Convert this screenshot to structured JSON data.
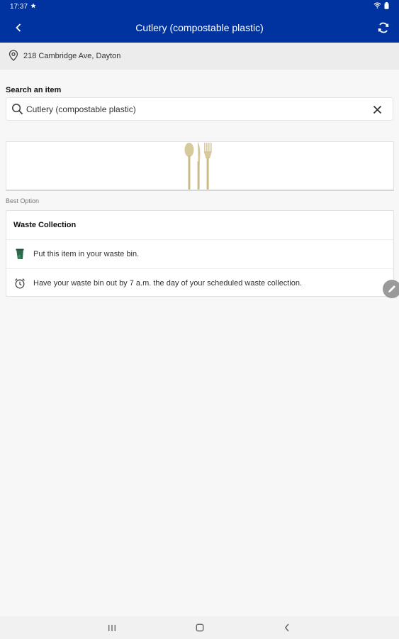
{
  "status_bar": {
    "time": "17:37"
  },
  "app_bar": {
    "title": "Cutlery (compostable plastic)"
  },
  "location": {
    "address": "218 Cambridge Ave, Dayton"
  },
  "search": {
    "label": "Search an item",
    "value": "Cutlery (compostable plastic)"
  },
  "best_option": {
    "label": "Best Option"
  },
  "result_card": {
    "title": "Waste Collection",
    "rows": [
      {
        "icon": "waste-bin-icon",
        "text": "Put this item in your waste bin."
      },
      {
        "icon": "alarm-clock-icon",
        "text": "Have your waste bin out by 7 a.m. the day of your scheduled waste collection."
      }
    ]
  },
  "colors": {
    "primary": "#0033a0",
    "bin_green": "#2e6b4a",
    "cutlery": "#d8c99b"
  }
}
